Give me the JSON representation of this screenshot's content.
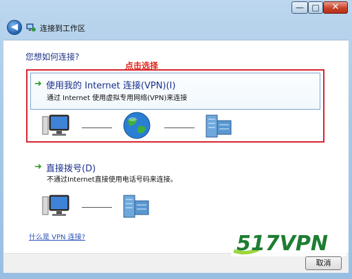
{
  "window": {
    "title": "连接到工作区",
    "controls": {
      "minimize": "—",
      "maximize": "□",
      "close": "✕"
    }
  },
  "main": {
    "question": "您想如何连接?",
    "hint": "点击选择",
    "options": [
      {
        "title": "使用我的 Internet 连接(VPN)(I)",
        "description": "通过 Internet 使用虚拟专用网络(VPN)来连接",
        "selected": true
      },
      {
        "title": "直接拨号(D)",
        "description": "不通过Internet直接使用电话号码来连接。",
        "selected": false
      }
    ],
    "help_link": "什么是 VPN 连接?"
  },
  "footer": {
    "cancel_label": "取消"
  },
  "watermark": {
    "text": "517VPN",
    "text_color": "#1e7d32",
    "accent_color": "#9dd63a"
  },
  "colors": {
    "hint": "#e0241b",
    "highlight_border": "#d3262c",
    "link": "#2a52b8",
    "heading": "#1e3287"
  }
}
